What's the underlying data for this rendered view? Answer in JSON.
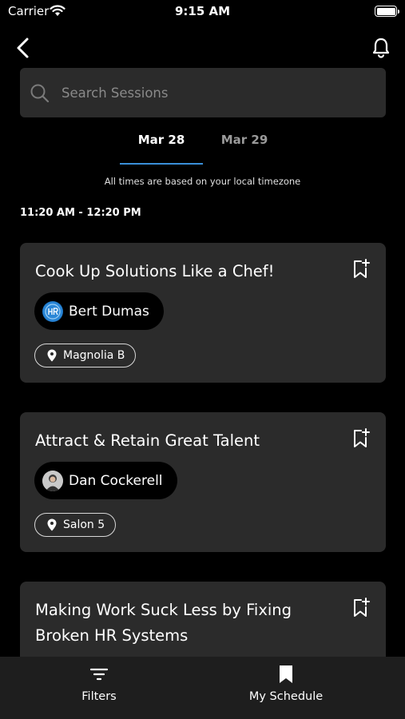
{
  "status_bar": {
    "carrier": "Carrier",
    "time": "9:15 AM"
  },
  "header": {
    "back_icon": "chevron-left-icon",
    "notification_icon": "bell-icon"
  },
  "search": {
    "placeholder": "Search Sessions",
    "value": ""
  },
  "date_tabs": [
    {
      "label": "Mar 28",
      "selected": true
    },
    {
      "label": "Mar 29",
      "selected": false
    }
  ],
  "timezone_note": "All times are based on your local timezone",
  "time_slot": "11:20 AM - 12:20 PM",
  "sessions": [
    {
      "title": "Cook Up Solutions Like a Chef!",
      "speaker": "Bert Dumas",
      "location": "Magnolia B"
    },
    {
      "title": "Attract & Retain Great Talent",
      "speaker": "Dan Cockerell",
      "location": "Salon 5"
    },
    {
      "title": "Making Work Suck Less by Fixing Broken HR Systems"
    }
  ],
  "bottom_nav": {
    "filters_label": "Filters",
    "schedule_label": "My Schedule"
  },
  "colors": {
    "background": "#000000",
    "card": "#2b2b2b",
    "accent": "#3a8fd9",
    "nav_background": "#1e1e1e"
  }
}
